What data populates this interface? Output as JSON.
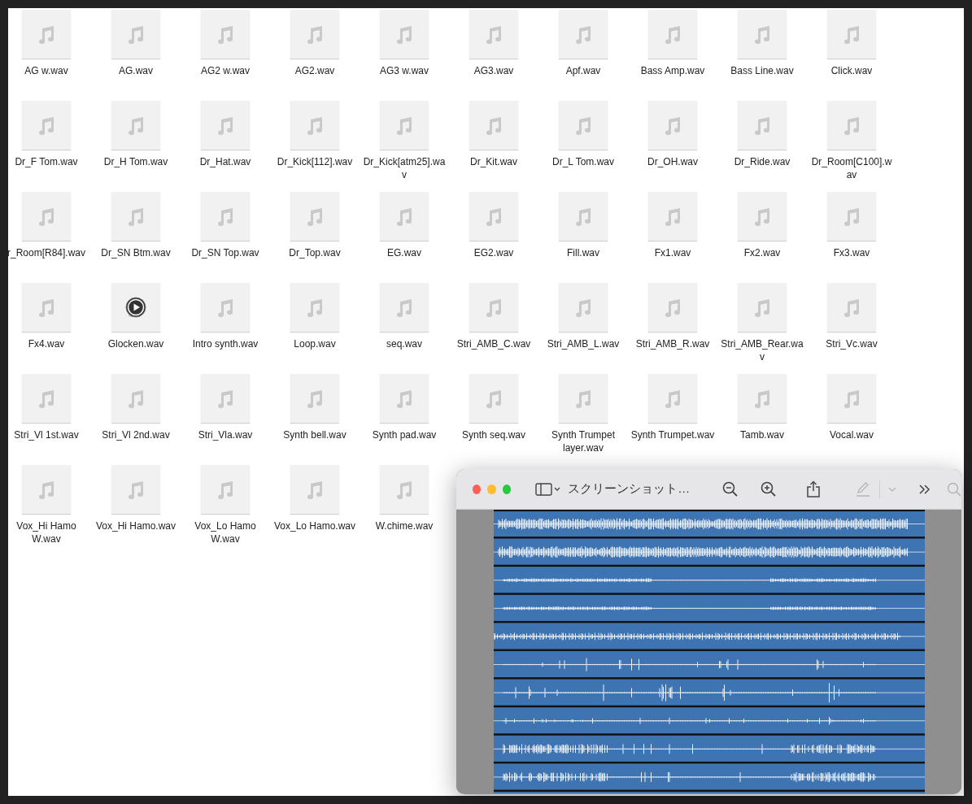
{
  "files": [
    {
      "name": "AG w.wav",
      "playing": false
    },
    {
      "name": "AG.wav",
      "playing": false
    },
    {
      "name": "AG2 w.wav",
      "playing": false
    },
    {
      "name": "AG2.wav",
      "playing": false
    },
    {
      "name": "AG3 w.wav",
      "playing": false
    },
    {
      "name": "AG3.wav",
      "playing": false
    },
    {
      "name": "Apf.wav",
      "playing": false
    },
    {
      "name": "Bass Amp.wav",
      "playing": false
    },
    {
      "name": "Bass Line.wav",
      "playing": false
    },
    {
      "name": "Click.wav",
      "playing": false
    },
    {
      "name": "Dr_F Tom.wav",
      "playing": false
    },
    {
      "name": "Dr_H Tom.wav",
      "playing": false
    },
    {
      "name": "Dr_Hat.wav",
      "playing": false
    },
    {
      "name": "Dr_Kick[112].wav",
      "playing": false
    },
    {
      "name": "Dr_Kick[atm25].wav",
      "playing": false
    },
    {
      "name": "Dr_Kit.wav",
      "playing": false
    },
    {
      "name": "Dr_L Tom.wav",
      "playing": false
    },
    {
      "name": "Dr_OH.wav",
      "playing": false
    },
    {
      "name": "Dr_Ride.wav",
      "playing": false
    },
    {
      "name": "Dr_Room[C100].wav",
      "playing": false
    },
    {
      "name": "r_Room[R84].wav",
      "playing": false
    },
    {
      "name": "Dr_SN Btm.wav",
      "playing": false
    },
    {
      "name": "Dr_SN Top.wav",
      "playing": false
    },
    {
      "name": "Dr_Top.wav",
      "playing": false
    },
    {
      "name": "EG.wav",
      "playing": false
    },
    {
      "name": "EG2.wav",
      "playing": false
    },
    {
      "name": "Fill.wav",
      "playing": false
    },
    {
      "name": "Fx1.wav",
      "playing": false
    },
    {
      "name": "Fx2.wav",
      "playing": false
    },
    {
      "name": "Fx3.wav",
      "playing": false
    },
    {
      "name": "Fx4.wav",
      "playing": false
    },
    {
      "name": "Glocken.wav",
      "playing": true
    },
    {
      "name": "Intro synth.wav",
      "playing": false
    },
    {
      "name": "Loop.wav",
      "playing": false
    },
    {
      "name": "seq.wav",
      "playing": false
    },
    {
      "name": "Stri_AMB_C.wav",
      "playing": false
    },
    {
      "name": "Stri_AMB_L.wav",
      "playing": false
    },
    {
      "name": "Stri_AMB_R.wav",
      "playing": false
    },
    {
      "name": "Stri_AMB_Rear.wav",
      "playing": false
    },
    {
      "name": "Stri_Vc.wav",
      "playing": false
    },
    {
      "name": "Stri_Vl 1st.wav",
      "playing": false
    },
    {
      "name": "Stri_Vl 2nd.wav",
      "playing": false
    },
    {
      "name": "Stri_Vla.wav",
      "playing": false
    },
    {
      "name": "Synth bell.wav",
      "playing": false
    },
    {
      "name": "Synth pad.wav",
      "playing": false
    },
    {
      "name": "Synth seq.wav",
      "playing": false
    },
    {
      "name": "Synth Trumpet layer.wav",
      "playing": false
    },
    {
      "name": "Synth Trumpet.wav",
      "playing": false
    },
    {
      "name": "Tamb.wav",
      "playing": false
    },
    {
      "name": "Vocal.wav",
      "playing": false
    },
    {
      "name": "Vox_Hi Hamo W.wav",
      "playing": false
    },
    {
      "name": "Vox_Hi Hamo.wav",
      "playing": false
    },
    {
      "name": "Vox_Lo Hamo W.wav",
      "playing": false
    },
    {
      "name": "Vox_Lo Hamo.wav",
      "playing": false
    },
    {
      "name": "W.chime.wav",
      "playing": false
    }
  ],
  "preview_window": {
    "title": "スクリーンショット…",
    "left_tools": [
      {
        "kind": "sidebar",
        "disabled": false
      }
    ],
    "right_tools": [
      {
        "kind": "zoom-out",
        "disabled": false
      },
      {
        "kind": "zoom-in",
        "disabled": false
      },
      {
        "kind": "share",
        "disabled": false
      },
      {
        "kind": "markup",
        "disabled": true
      },
      {
        "kind": "divider"
      },
      {
        "kind": "markup-menu",
        "disabled": true
      },
      {
        "kind": "more",
        "disabled": false
      },
      {
        "kind": "search",
        "disabled": true
      }
    ]
  }
}
